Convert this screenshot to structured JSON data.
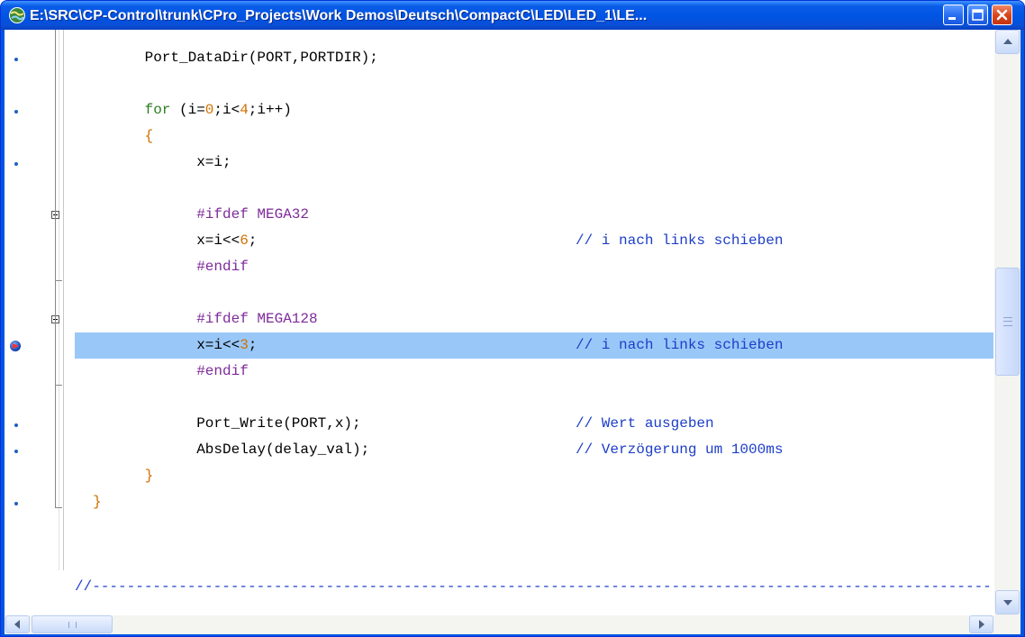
{
  "window": {
    "title": "E:\\SRC\\CP-Control\\trunk\\CPro_Projects\\Work Demos\\Deutsch\\CompactC\\LED\\LED_1\\LE...",
    "icon": "app-globe-icon",
    "buttons": [
      "minimize-icon",
      "maximize-icon",
      "close-icon"
    ]
  },
  "colors": {
    "titlebar": "#0054e3",
    "selection": "#99c8f8",
    "keyword": "#2b7d1e",
    "preprocessor": "#7e2b9a",
    "comment": "#1d3ec8",
    "number": "#d07000",
    "breakpoint_dot": "#1e5fc0"
  },
  "code": {
    "lines": [
      {
        "indent": "    ",
        "segments": [
          {
            "t": "Port_DataDir(PORT,PORTDIR);",
            "k": "def"
          }
        ]
      },
      {
        "indent": "    ",
        "segments": [
          {
            "t": "for",
            "k": "kw"
          },
          {
            "t": " (i=",
            "k": "def"
          },
          {
            "t": "0",
            "k": "num"
          },
          {
            "t": ";i<",
            "k": "def"
          },
          {
            "t": "4",
            "k": "num"
          },
          {
            "t": ";i++)",
            "k": "def"
          }
        ]
      },
      {
        "indent": "    ",
        "segments": [
          {
            "t": "{",
            "k": "num"
          }
        ]
      },
      {
        "indent": "        ",
        "segments": [
          {
            "t": "x=i;",
            "k": "def"
          }
        ]
      },
      {
        "indent": "        ",
        "segments": [
          {
            "t": "#ifdef MEGA32",
            "k": "pre"
          }
        ]
      },
      {
        "indent": "        ",
        "segments": [
          {
            "t": "x=i<<",
            "k": "def"
          },
          {
            "t": "6",
            "k": "num"
          },
          {
            "t": ";",
            "k": "def"
          }
        ],
        "comment": "// i nach links schieben"
      },
      {
        "indent": "        ",
        "segments": [
          {
            "t": "#endif",
            "k": "pre"
          }
        ]
      },
      {
        "indent": "        ",
        "segments": [
          {
            "t": "#ifdef MEGA128",
            "k": "pre"
          }
        ]
      },
      {
        "indent": "        ",
        "segments": [
          {
            "t": "x=i<<",
            "k": "def"
          },
          {
            "t": "3",
            "k": "num"
          },
          {
            "t": ";",
            "k": "def"
          }
        ],
        "comment": "// i nach links schieben"
      },
      {
        "indent": "        ",
        "segments": [
          {
            "t": "#endif",
            "k": "pre"
          }
        ]
      },
      {
        "indent": "        ",
        "segments": [
          {
            "t": "Port_Write(PORT,x);",
            "k": "def"
          }
        ],
        "comment": "// Wert ausgeben"
      },
      {
        "indent": "        ",
        "segments": [
          {
            "t": "AbsDelay(delay_val);",
            "k": "def"
          }
        ],
        "comment": "// Verzögerung um 1000ms"
      },
      {
        "indent": "    ",
        "segments": [
          {
            "t": "}",
            "k": "num"
          }
        ]
      },
      {
        "indent": "",
        "segments": [
          {
            "t": "}",
            "k": "num"
          }
        ]
      }
    ],
    "bottom_comment": "//----------------------------------------------------------------------------------------------------------",
    "current_line": 8
  },
  "scrollbars": {
    "vertical": {
      "up": "scroll-up-arrow-icon",
      "down": "scroll-down-arrow-icon"
    },
    "horizontal": {
      "left": "scroll-left-arrow-icon",
      "right": "scroll-right-arrow-icon"
    }
  }
}
